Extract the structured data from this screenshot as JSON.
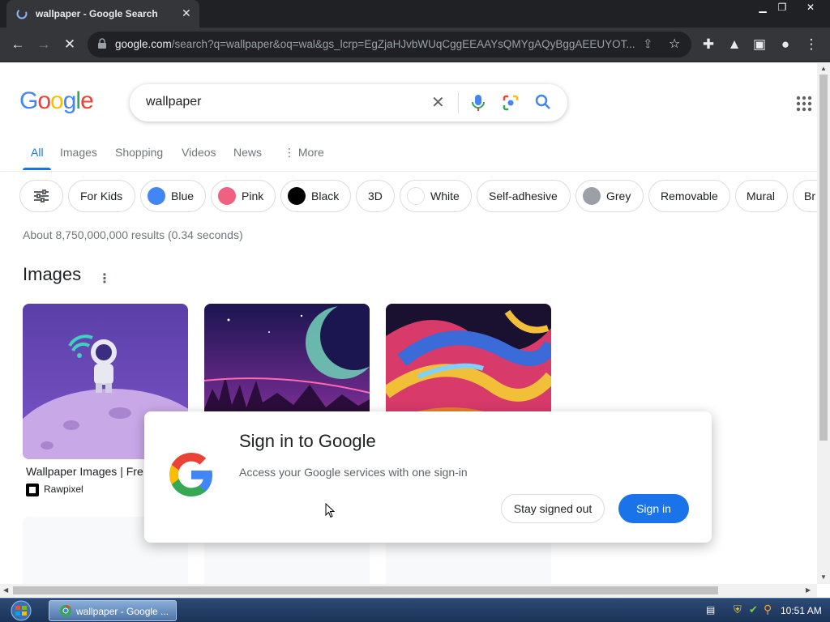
{
  "browser": {
    "tab_title": "wallpaper - Google Search",
    "url_host": "google.com",
    "url_path": "/search?q=wallpaper&oq=wal&gs_lcrp=EgZjaHJvbWUqCggEEAAYsQMYgAQyBggAEEUYOT..."
  },
  "search": {
    "query": "wallpaper",
    "logo": "Google"
  },
  "nav_tabs": [
    "All",
    "Images",
    "Shopping",
    "Videos",
    "News",
    "More"
  ],
  "chips": [
    {
      "label": "For Kids"
    },
    {
      "label": "Blue",
      "color": "#4285f4"
    },
    {
      "label": "Pink",
      "color": "#f06080"
    },
    {
      "label": "Black",
      "color": "#000000"
    },
    {
      "label": "3D"
    },
    {
      "label": "White",
      "color": "#ffffff"
    },
    {
      "label": "Self-adhesive"
    },
    {
      "label": "Grey",
      "color": "#9aa0a6"
    },
    {
      "label": "Removable"
    },
    {
      "label": "Mural"
    },
    {
      "label": "Br"
    }
  ],
  "stats": "About 8,750,000,000 results (0.34 seconds)",
  "images_section": {
    "title": "Images",
    "first_result_title": "Wallpaper Images | Fre",
    "first_result_source": "Rawpixel"
  },
  "dialog": {
    "title": "Sign in to Google",
    "subtitle": "Access your Google services with one sign-in",
    "stay_label": "Stay signed out",
    "sign_label": "Sign in"
  },
  "taskbar": {
    "app_label": "wallpaper - Google ...",
    "clock": "10:51 AM"
  }
}
